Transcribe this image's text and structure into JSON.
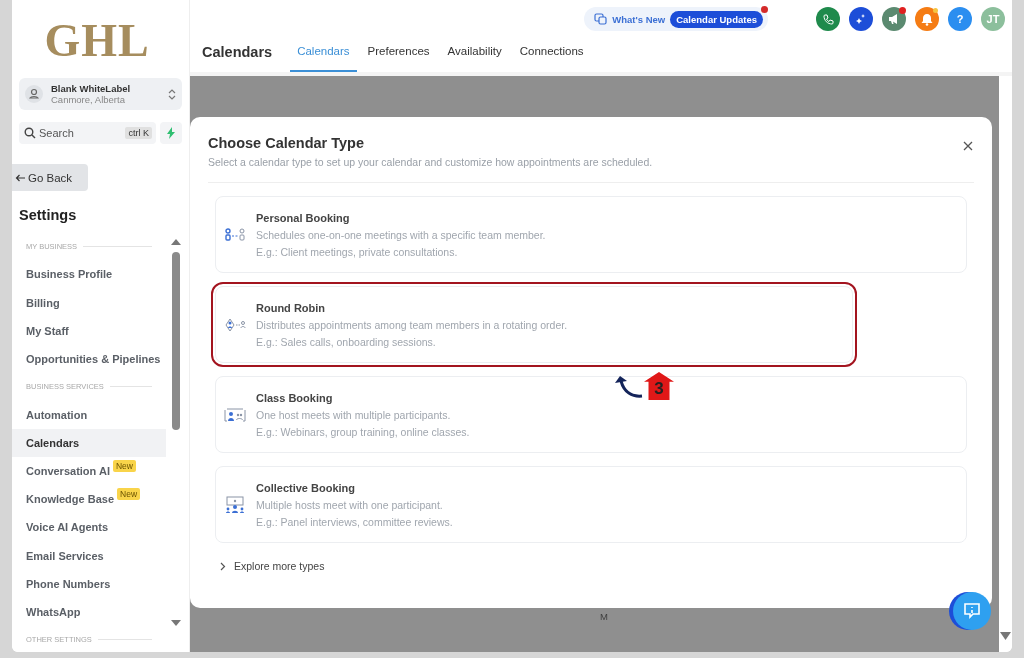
{
  "sidebar": {
    "logo": "GHL",
    "account": {
      "name": "Blank WhiteLabel",
      "location": "Canmore, Alberta"
    },
    "search": {
      "placeholder": "Search",
      "shortcut": "ctrl K"
    },
    "back_button": "Go Back",
    "title": "Settings",
    "items": [
      {
        "kind": "section",
        "label": "MY BUSINESS"
      },
      {
        "kind": "link",
        "label": "Business Profile",
        "selected": false
      },
      {
        "kind": "link",
        "label": "Billing",
        "selected": false
      },
      {
        "kind": "link",
        "label": "My Staff",
        "selected": false
      },
      {
        "kind": "link",
        "label": "Opportunities & Pipelines",
        "selected": false
      },
      {
        "kind": "section",
        "label": "BUSINESS SERVICES"
      },
      {
        "kind": "link",
        "label": "Automation",
        "selected": false
      },
      {
        "kind": "link",
        "label": "Calendars",
        "selected": true
      },
      {
        "kind": "link",
        "label": "Conversation AI",
        "selected": false,
        "badge": "New"
      },
      {
        "kind": "link",
        "label": "Knowledge Base",
        "selected": false,
        "badge": "New"
      },
      {
        "kind": "link",
        "label": "Voice AI Agents",
        "selected": false
      },
      {
        "kind": "link",
        "label": "Email Services",
        "selected": false
      },
      {
        "kind": "link",
        "label": "Phone Numbers",
        "selected": false
      },
      {
        "kind": "link",
        "label": "WhatsApp",
        "selected": false
      },
      {
        "kind": "section",
        "label": "OTHER SETTINGS"
      }
    ]
  },
  "header": {
    "whats_new": "What's New",
    "updates": "Calendar Updates",
    "help": "?",
    "avatar": "JT",
    "page_title": "Calendars",
    "tabs": [
      {
        "label": "Calendars",
        "selected": true
      },
      {
        "label": "Preferences",
        "selected": false
      },
      {
        "label": "Availability",
        "selected": false
      },
      {
        "label": "Connections",
        "selected": false
      }
    ]
  },
  "background": {
    "column_label": "M"
  },
  "modal": {
    "title": "Choose Calendar Type",
    "subtitle": "Select a calendar type to set up your calendar and customize how appointments are scheduled.",
    "options": [
      {
        "kind": "personal",
        "title": "Personal Booking",
        "description": "Schedules one-on-one meetings with a specific team member.",
        "example": "E.g.: Client meetings, private consultations.",
        "annotated": false
      },
      {
        "kind": "round_robin",
        "title": "Round Robin",
        "description": "Distributes appointments among team members in a rotating order.",
        "example": "E.g.: Sales calls, onboarding sessions.",
        "annotated": true
      },
      {
        "kind": "class",
        "title": "Class Booking",
        "description": "One host meets with multiple participants.",
        "example": "E.g.: Webinars, group training, online classes.",
        "annotated": false
      },
      {
        "kind": "collective",
        "title": "Collective Booking",
        "description": "Multiple hosts meet with one participant.",
        "example": "E.g.: Panel interviews, committee reviews.",
        "annotated": false
      }
    ],
    "explore": "Explore more types"
  },
  "annotation": {
    "step": "3"
  }
}
